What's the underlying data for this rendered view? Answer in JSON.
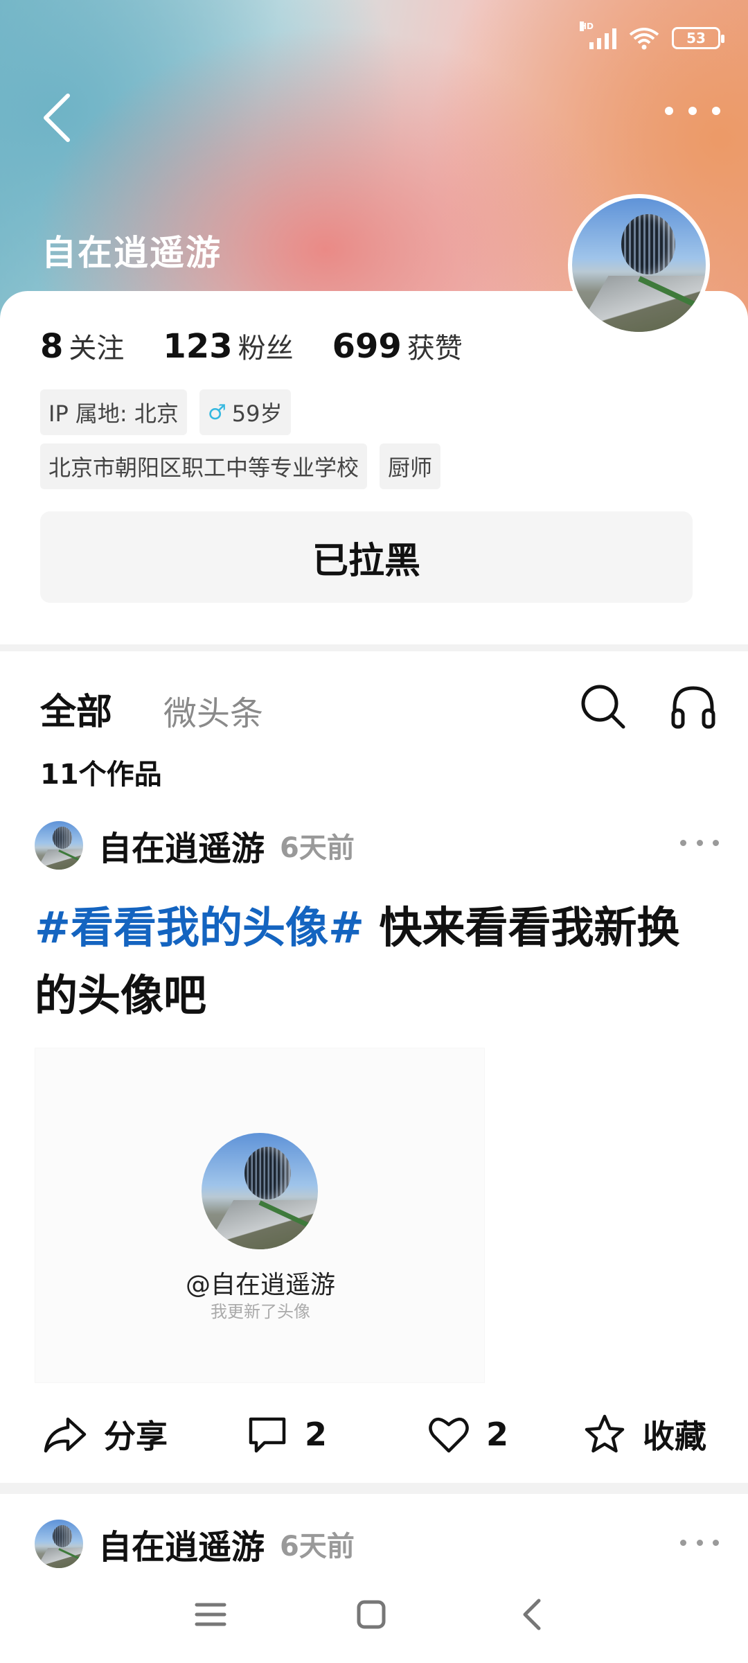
{
  "status_bar": {
    "network": "HD",
    "battery": "53"
  },
  "profile": {
    "name": "自在逍遥游",
    "stats": [
      {
        "num": "8",
        "label": "关注"
      },
      {
        "num": "123",
        "label": "粉丝"
      },
      {
        "num": "699",
        "label": "获赞"
      }
    ],
    "ip_location": "IP 属地: 北京",
    "gender_symbol": "♂",
    "age": "59岁",
    "school": "北京市朝阳区职工中等专业学校",
    "occupation": "厨师",
    "blocked_label": "已拉黑"
  },
  "tabs": {
    "all": "全部",
    "weitoutiao": "微头条"
  },
  "works_count": "11个作品",
  "posts": [
    {
      "author": "自在逍遥游",
      "time": "6天前",
      "hashtag": "#看看我的头像#",
      "text": " 快来看看我新换的头像吧",
      "card_name": "@自在逍遥游",
      "card_sub": "我更新了头像",
      "share_label": "分享",
      "comments": "2",
      "likes": "2",
      "favorite_label": "收藏"
    },
    {
      "author": "自在逍遥游",
      "time": "6天前"
    }
  ],
  "colors": {
    "hashtag": "#1464c0",
    "gender": "#35b8e0"
  }
}
